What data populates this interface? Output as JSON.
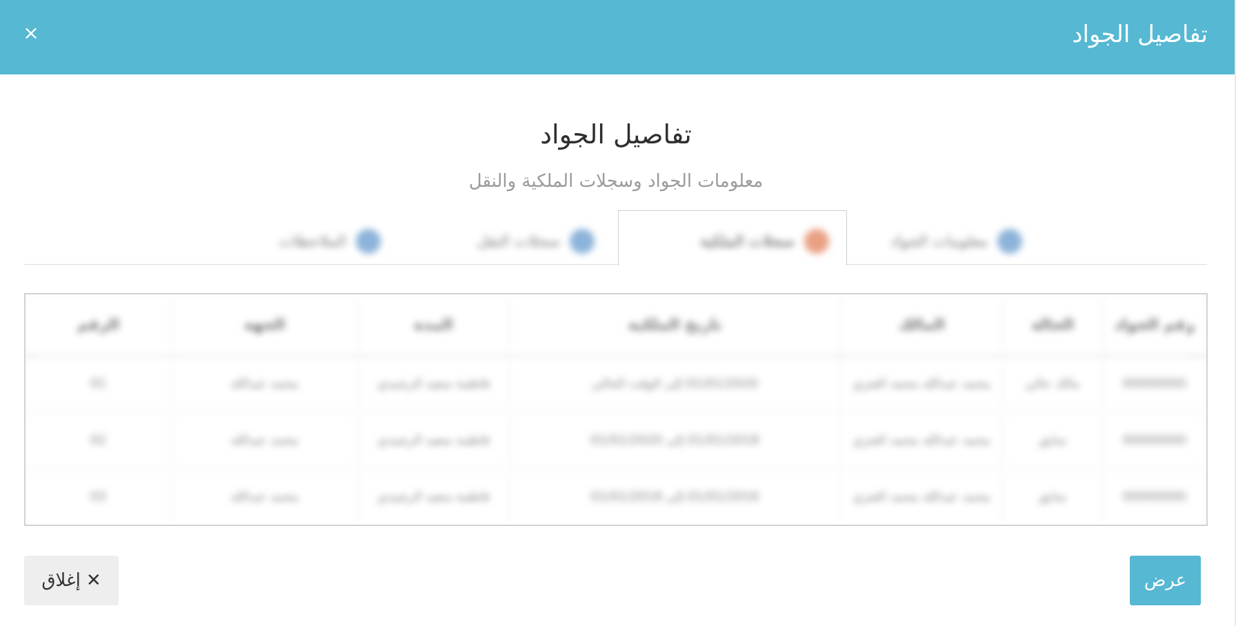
{
  "modal": {
    "title": "تفاصيل الجواد",
    "close_symbol": "×"
  },
  "content": {
    "title": "تفاصيل الجواد",
    "subtitle": "معلومات الجواد وسجلات الملكية والنقل"
  },
  "tabs": [
    {
      "label": "معلومات الجواد",
      "icon": "info-icon",
      "active": false
    },
    {
      "label": "سجلات الملكية",
      "icon": "document-icon",
      "active": true
    },
    {
      "label": "سجلات النقل",
      "icon": "transfer-icon",
      "active": false
    },
    {
      "label": "الملاحظات",
      "icon": "notes-icon",
      "active": false
    }
  ],
  "table": {
    "headers": [
      "رقم الجواد",
      "الحالة",
      "المالك",
      "تاريخ الملكية",
      "المدة",
      "الجهة",
      "الرقم"
    ],
    "rows": [
      [
        "00000000",
        "مالك حالي",
        "محمد عبدالله محمد العنزي",
        "01/01/2020 إلى الوقت الحالي",
        "فاطمة سعيد الرشيدي",
        "محمد عبدالله",
        "01"
      ],
      [
        "00000000",
        "سابق",
        "محمد عبدالله محمد العنزي",
        "01/01/2018 إلى 01/01/2020",
        "فاطمة سعيد الرشيدي",
        "محمد عبدالله",
        "02"
      ],
      [
        "00000000",
        "سابق",
        "محمد عبدالله محمد العنزي",
        "01/01/2016 إلى 01/01/2018",
        "فاطمة سعيد الرشيدي",
        "محمد عبدالله",
        "03"
      ]
    ]
  },
  "footer": {
    "view_label": "عرض",
    "close_label": "إغلاق",
    "close_glyph": "✕"
  },
  "colors": {
    "header_bg": "#56b8d3",
    "primary_button": "#56b8d3",
    "secondary_button": "#eeeeee",
    "subtitle_text": "#9a9a9a"
  }
}
